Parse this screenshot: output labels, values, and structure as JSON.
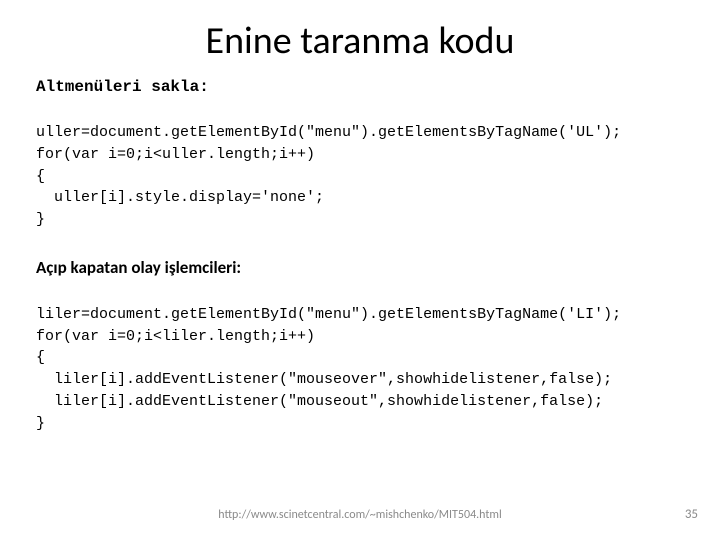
{
  "title": "Enine taranma kodu",
  "section1_label": "Altmenüleri sakla:",
  "code1": "uller=document.getElementById(\"menu\").getElementsByTagName('UL');\nfor(var i=0;i<uller.length;i++)\n{\n  uller[i].style.display='none';\n}",
  "section2_label": "Açıp kapatan olay işlemcileri:",
  "code2": "liler=document.getElementById(\"menu\").getElementsByTagName('LI');\nfor(var i=0;i<liler.length;i++)\n{\n  liler[i].addEventListener(\"mouseover\",showhidelistener,false);\n  liler[i].addEventListener(\"mouseout\",showhidelistener,false);\n}",
  "footer_url": "http://www.scinetcentral.com/~mishchenko/MIT504.html",
  "page_number": "35"
}
